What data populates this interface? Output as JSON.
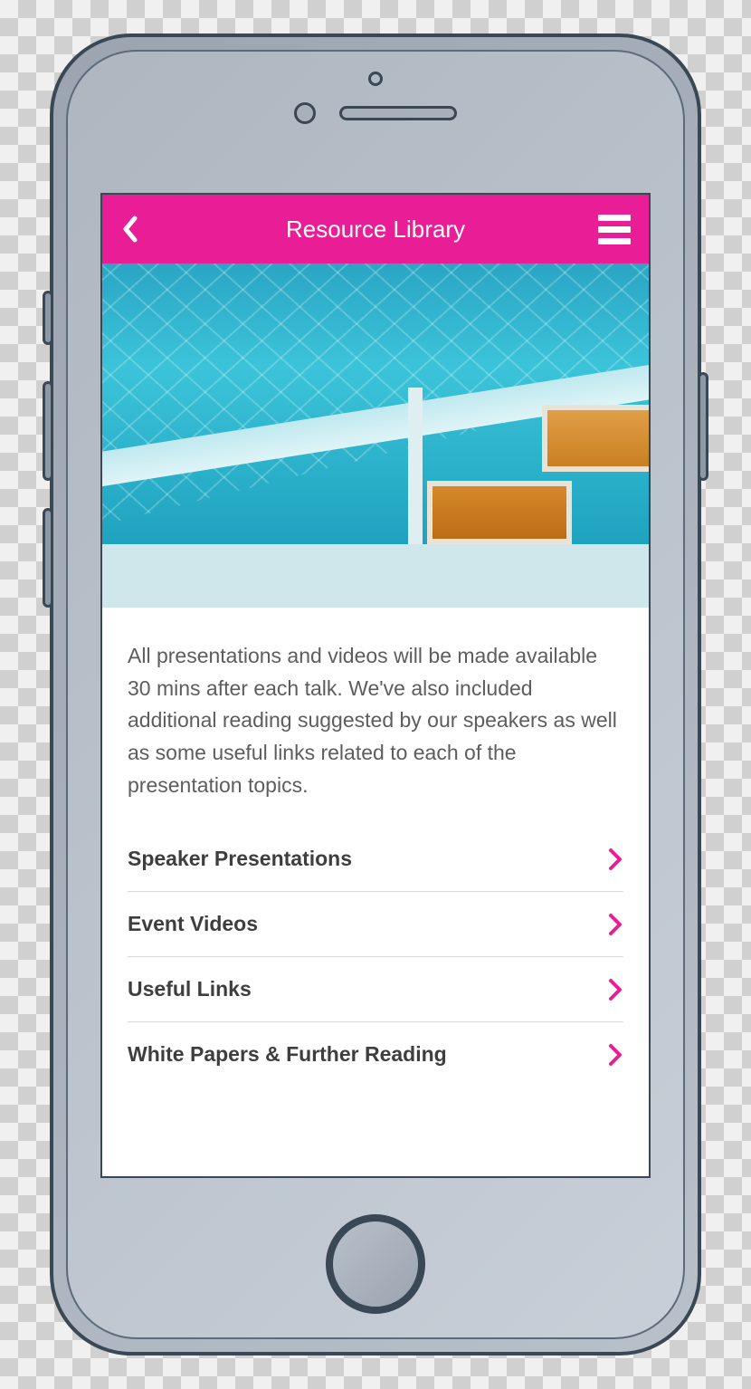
{
  "nav": {
    "title": "Resource Library"
  },
  "description": "All presentations and videos will be made available 30 mins after each talk. We've also included additional reading suggested by our speakers as well as some useful links related to each of the presentation topics.",
  "items": [
    {
      "label": "Speaker Presentations"
    },
    {
      "label": "Event Videos"
    },
    {
      "label": "Useful Links"
    },
    {
      "label": "White Papers & Further Reading"
    }
  ],
  "colors": {
    "accent": "#e91e96"
  }
}
